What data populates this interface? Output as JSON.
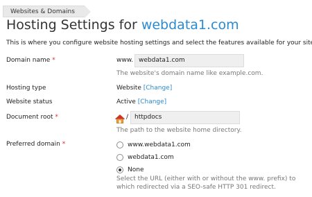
{
  "breadcrumb": {
    "label": "Websites & Domains"
  },
  "title": {
    "prefix": "Hosting Settings for ",
    "domain": "webdata1.com"
  },
  "intro": "This is where you configure website hosting settings and select the features available for your site.",
  "required_marker": "*",
  "fields": {
    "domain_name": {
      "label": "Domain name ",
      "prefix": "www.",
      "value": "webdata1.com",
      "hint": "The website's domain name like example.com."
    },
    "hosting_type": {
      "label": "Hosting type",
      "value": "Website ",
      "link": "[Change]"
    },
    "website_status": {
      "label": "Website status",
      "value": "Active ",
      "link": "[Change]"
    },
    "document_root": {
      "label": "Document root ",
      "slash": "/",
      "value": "httpdocs",
      "hint": "The path to the website home directory."
    },
    "preferred_domain": {
      "label": "Preferred domain ",
      "options": [
        {
          "label": "www.webdata1.com",
          "checked": false
        },
        {
          "label": "webdata1.com",
          "checked": false
        },
        {
          "label": "None",
          "checked": true
        }
      ],
      "hint": "Select the URL (either with or without the www. prefix) to which redirected via a SEO-safe HTTP 301 redirect."
    }
  },
  "colors": {
    "link": "#2a8ad1",
    "required": "#d2302f",
    "hint": "#777777"
  },
  "icons": {
    "document_root": "home-icon"
  }
}
